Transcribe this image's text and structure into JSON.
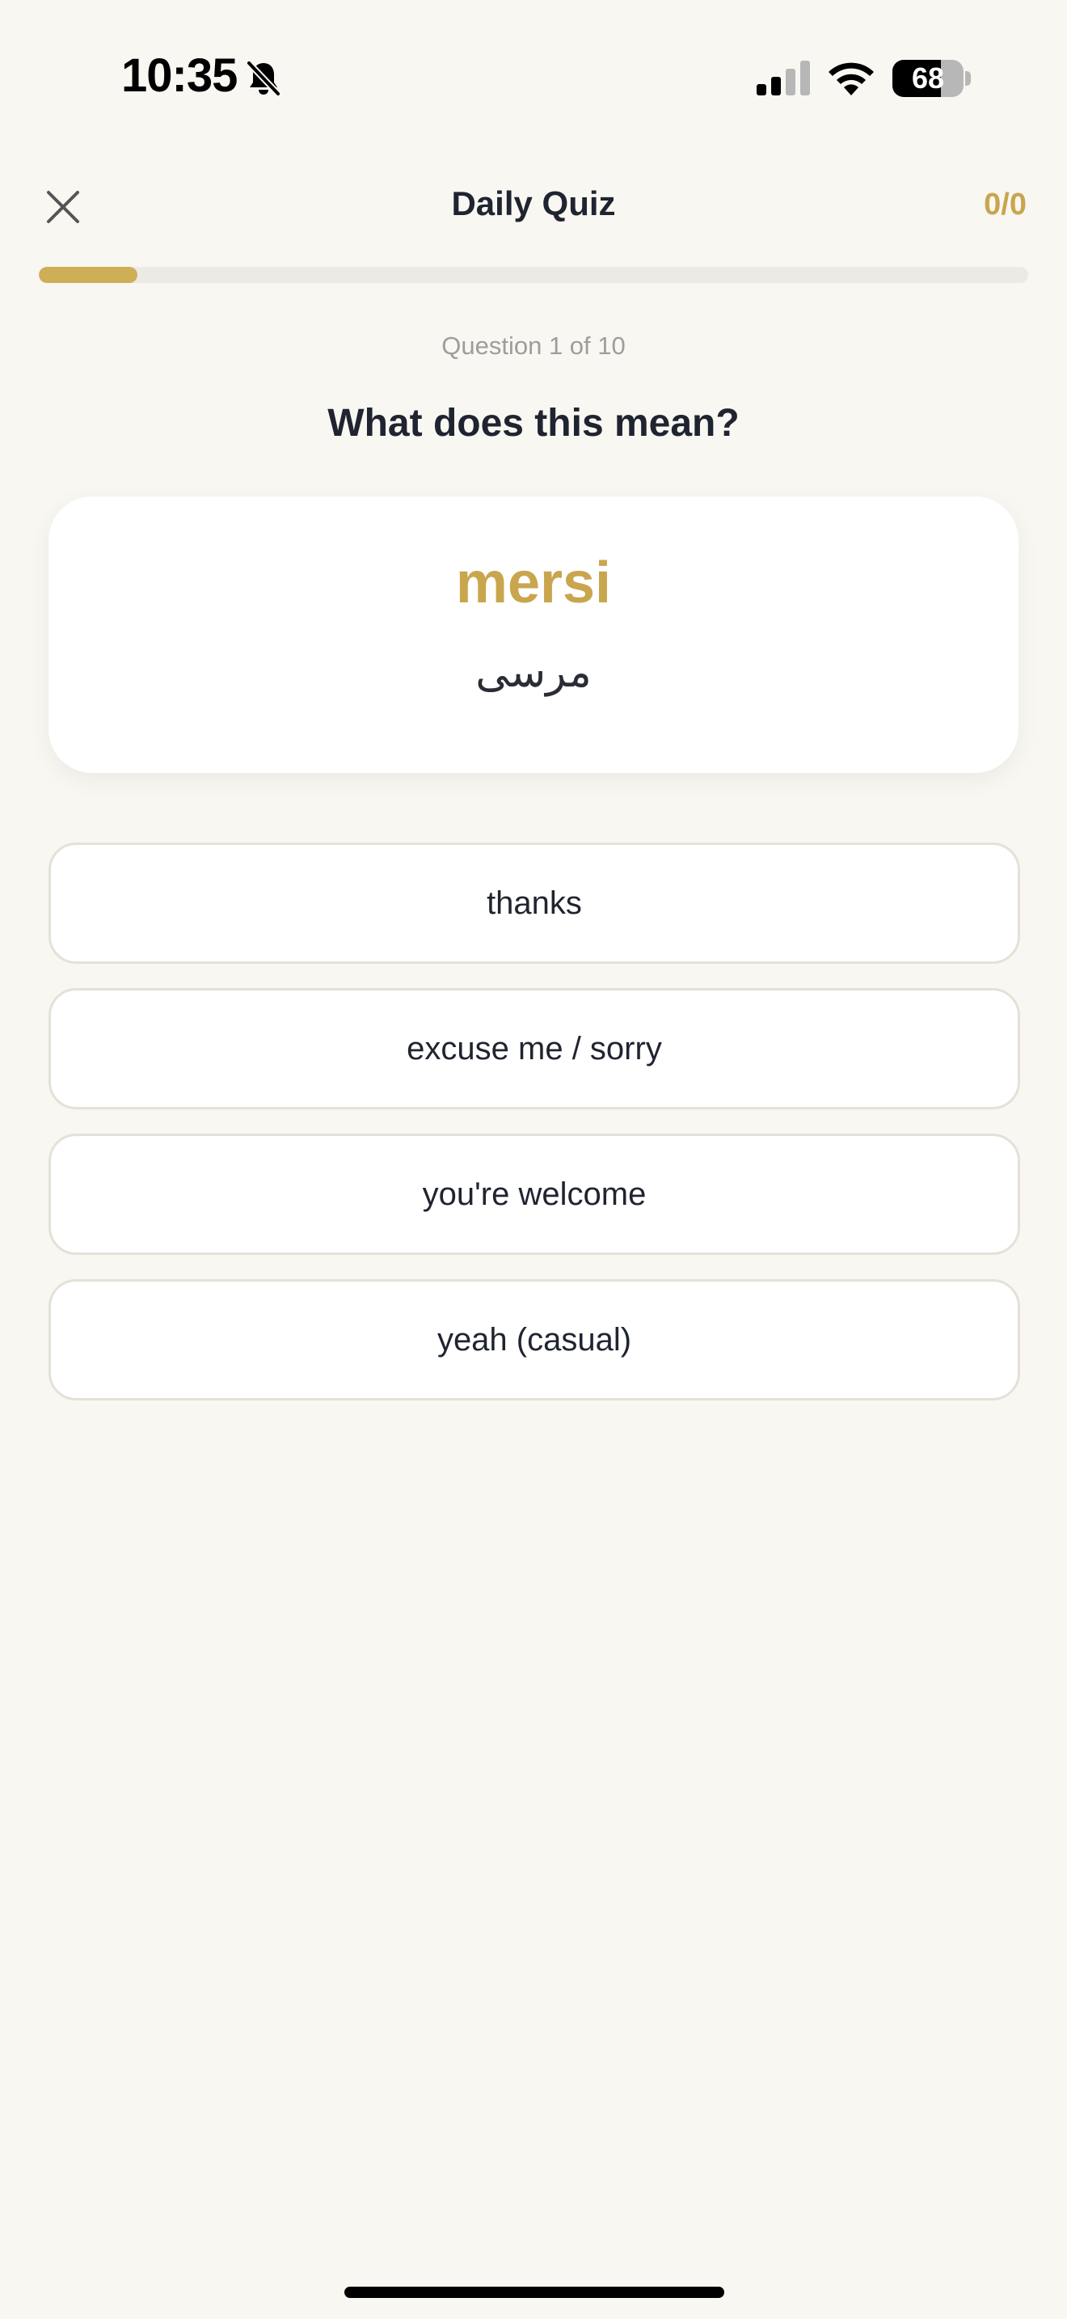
{
  "status_bar": {
    "time": "10:35",
    "battery_percent": "68",
    "battery_level": 0.68,
    "icons": [
      "bell-slash-icon",
      "cellular-signal-icon",
      "wifi-icon",
      "battery-icon"
    ]
  },
  "header": {
    "close_icon": "close-icon",
    "title": "Daily Quiz",
    "score": "0/0"
  },
  "progress": {
    "fraction": 0.1
  },
  "question": {
    "counter": "Question 1 of 10",
    "prompt": "What does this mean?"
  },
  "word": {
    "latin": "mersi",
    "native": "مرسی"
  },
  "options": [
    {
      "label": "thanks"
    },
    {
      "label": "excuse me / sorry"
    },
    {
      "label": "you're welcome"
    },
    {
      "label": "yeah (casual)"
    }
  ],
  "colors": {
    "accent": "#c9a54e",
    "background": "#f9f7f2",
    "card": "#ffffff",
    "option_border": "#e4e1d8",
    "muted_text": "#9d9d9d"
  }
}
